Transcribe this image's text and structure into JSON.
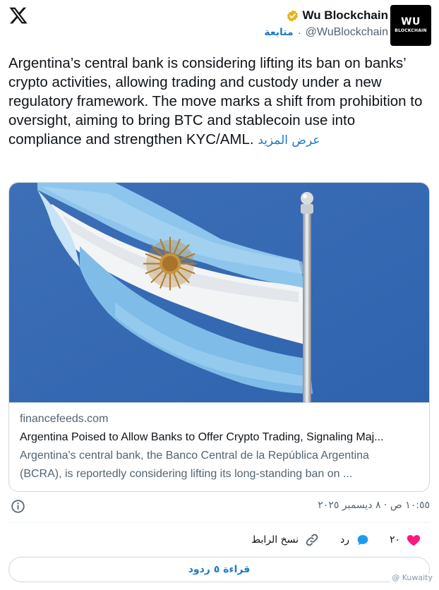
{
  "header": {
    "display_name": "Wu Blockchain",
    "handle": "@WuBlockchain",
    "separator": "·",
    "follow_label": "متابعة",
    "avatar": {
      "line1": "WU",
      "line2": "BLOCKCHAIN"
    }
  },
  "tweet": {
    "text": "Argentina’s central bank is considering lifting its ban on banks’ crypto activities, allowing trading and custody under a new regulatory framework. The move marks a shift from prohibition to oversight, aiming to bring BTC and stablecoin use into compliance and strengthen KYC/AML.",
    "show_more_label": "عرض المزيد"
  },
  "card": {
    "domain": "financefeeds.com",
    "title": "Argentina Poised to Allow Banks to Offer Crypto Trading, Signaling Maj...",
    "description_line1": "Argentina's central bank, the Banco Central de la República Argentina",
    "description_line2": "(BCRA), is reportedly considering lifting its long-standing ban on ..."
  },
  "meta": {
    "timestamp": "١٠:٥٥ ص · ٨ ديسمبر ٢٠٢٥"
  },
  "actions": {
    "like_count": "٢٠",
    "reply_label": "رد",
    "copy_link_label": "نسخ الرابط"
  },
  "read_replies_label": "قراءة ٥ ردود",
  "watermark": "@ Kuwaity",
  "colors": {
    "accent": "#1d7ac9",
    "like": "#f91880",
    "secondary_text": "#536471",
    "border": "#cfd9de",
    "verified_badge": "#e2b719"
  }
}
